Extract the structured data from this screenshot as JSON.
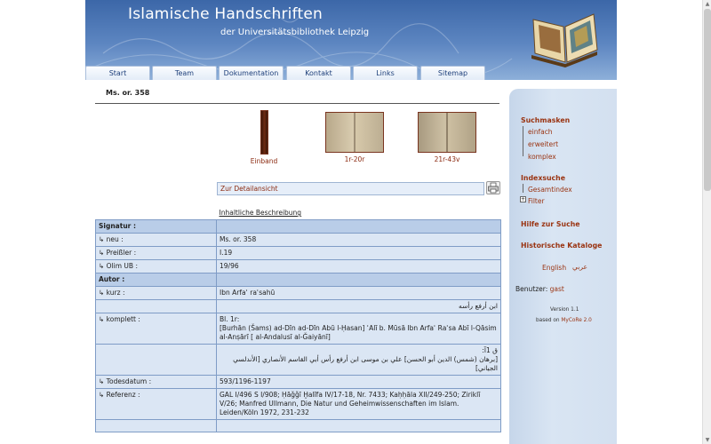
{
  "header": {
    "title": "Islamische Handschriften",
    "subtitle": "der Universitätsbibliothek Leipzig"
  },
  "nav": {
    "tabs": [
      "Start",
      "Team",
      "Dokumentation",
      "Kontakt",
      "Links",
      "Sitemap"
    ]
  },
  "record": {
    "title": "Ms. or. 358",
    "thumbnails": [
      {
        "caption": "Einband"
      },
      {
        "caption": "1r-20r"
      },
      {
        "caption": "21r-43v"
      }
    ],
    "detail_link": "Zur Detailansicht",
    "description_link": "Inhaltliche Beschreibung"
  },
  "table": {
    "signatur": "Signatur :",
    "neu_label": "↳ neu :",
    "neu_value": "Ms. or. 358",
    "preissler_label": "↳ Preißler :",
    "preissler_value": "I.19",
    "olim_label": "↳ Olim UB :",
    "olim_value": "19/96",
    "autor": "Autor :",
    "kurz_label": "↳ kurz :",
    "kurz_value": "Ibn Arfaʿ raʾsahū",
    "kurz_arabic": "ابن أرفع رأسه",
    "komplett_label": "↳ komplett :",
    "komplett_bl": "Bl. 1r:",
    "komplett_value": "[Burhān (Šams) ad-Dīn ad-Dīn Abū l-Ḥasan] ʿAlī b. Mūsā Ibn Arfaʿ Raʾsa Abī l-Qāsim al-Anṣārī [ al-Andalusī al-Ǧaiyānī]",
    "komplett_arabic_1": "ق 1آ:",
    "komplett_arabic_2": "[برهان (شمس) الدين أبو الحسن] علي بن موسى ابن أرفع رأس أبي القاسم الأنصاري [الأندلسي الجياني]",
    "tod_label": "↳ Todesdatum :",
    "tod_value": "593/1196-1197",
    "ref_label": "↳ Referenz :",
    "ref_value": "GAL I/496 S I/908; Ḥāǧǧī Ḫalīfa IV/17-18, Nr. 7433; Kaḥḥāla XII/249-250; Ziriklī V/26; Manfred Ullmann, Die Natur und Geheimwissenschaften im Islam. Leiden/Köln 1972, 231-232"
  },
  "sidebar": {
    "suchmasken": "Suchmasken",
    "einfach": "einfach",
    "erweitert": "erweitert",
    "komplex": "komplex",
    "indexsuche": "Indexsuche",
    "gesamtindex": "Gesamtindex",
    "filter": "Filter",
    "hilfe": "Hilfe zur Suche",
    "kataloge": "Historische Kataloge",
    "english": "English",
    "arabic": "عربي",
    "benutzer_label": "Benutzer:",
    "benutzer_value": "gast",
    "version": "Version 1.1",
    "based_on": "based on",
    "mycore": "MyCoRe 2.0"
  },
  "colors": {
    "header_blue": "#3c67a8",
    "link_red": "#9a3412",
    "table_blue": "#dbe6f4"
  }
}
